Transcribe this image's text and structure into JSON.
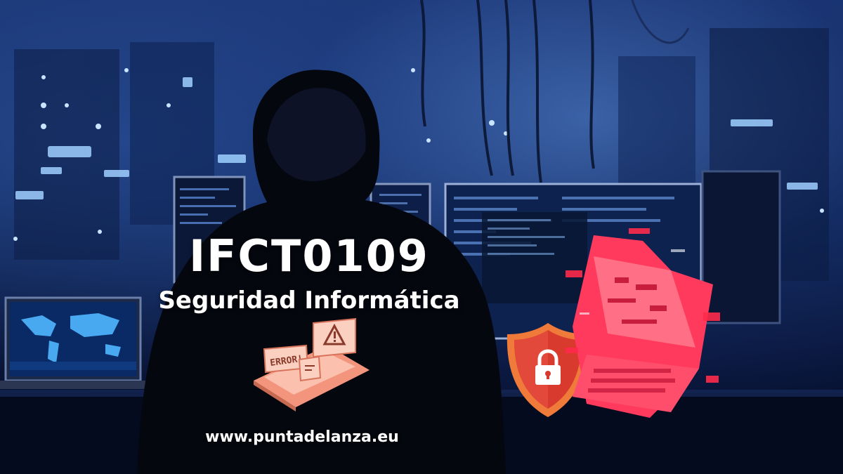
{
  "banner": {
    "code": "IFCT0109",
    "subtitle": "Seguridad Informática",
    "website": "www.puntadelanza.eu"
  },
  "illustrations": {
    "error_badge": "ERROR!",
    "error_card_icon": "warning-triangle-icon",
    "shield_icon": "padlock-shield-icon",
    "laptop_icon": "glitched-laptop-icon"
  },
  "colors": {
    "text": "#ffffff",
    "shield_red": "#d93a2e",
    "shield_rim": "#f07a3a",
    "laptop_pink": "#ff3a5c",
    "error_card_peach": "#f6a48c",
    "background_blue": "#17306a"
  }
}
